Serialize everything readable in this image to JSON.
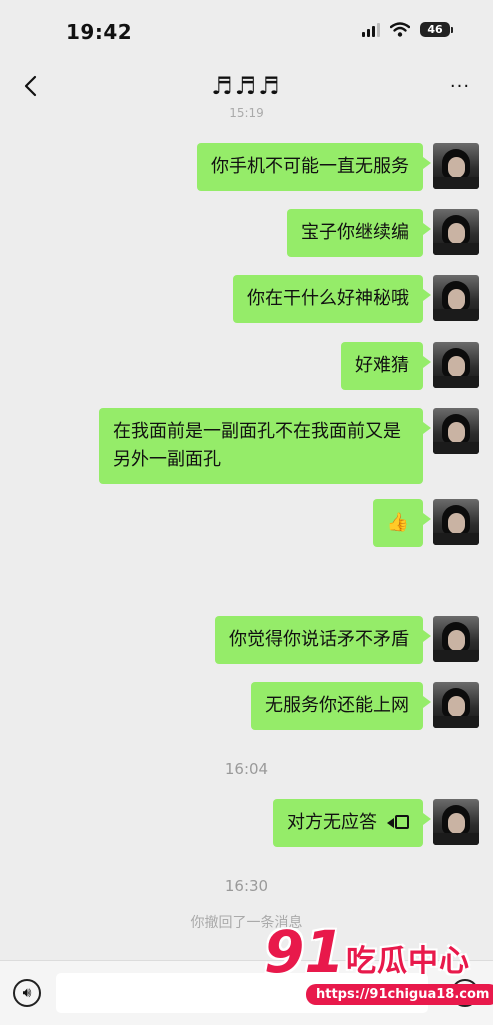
{
  "status_bar": {
    "time": "19:42",
    "battery": "46"
  },
  "nav": {
    "title": "♬♬♬",
    "more": "···"
  },
  "top_time": "15:19",
  "messages": [
    {
      "text": "你手机不可能一直无服务"
    },
    {
      "text": "宝子你继续编"
    },
    {
      "text": "你在干什么好神秘哦"
    },
    {
      "text": "好难猜"
    },
    {
      "text": "在我面前是一副面孔不在我面前又是另外一副面孔"
    },
    {
      "text": "👍"
    },
    {
      "text": "你觉得你说话矛不矛盾"
    },
    {
      "text": "无服务你还能上网"
    },
    {
      "text": "对方无应答"
    }
  ],
  "times": {
    "t1": "16:04",
    "t2": "16:30"
  },
  "recall_notice": "你撤回了一条消息",
  "input": {
    "placeholder": ""
  },
  "watermark": {
    "number": "91",
    "brand": "吃瓜中心",
    "url": "https://91chigua18.com"
  }
}
